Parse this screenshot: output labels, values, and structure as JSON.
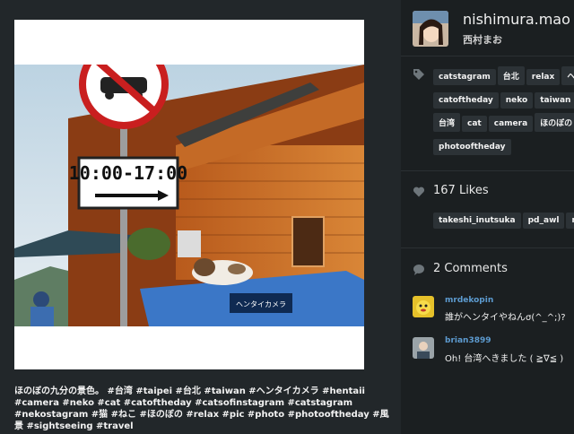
{
  "profile": {
    "username": "nishimura.mao",
    "real_name": "西村まお"
  },
  "tags": [
    "catstagram",
    "台北",
    "relax",
    "ヘン",
    "catoftheday",
    "neko",
    "taiwan",
    "n",
    "台湾",
    "cat",
    "camera",
    "ほのぼの",
    "photooftheday"
  ],
  "likes": {
    "count_label": "167 Likes",
    "users": [
      "takeshi_inutsuka",
      "pd_awl",
      "rinl"
    ]
  },
  "comments": {
    "title": "2 Comments",
    "items": [
      {
        "user": "mrdekopin",
        "text": "誰がヘンタイやねんσ(^_^;)?"
      },
      {
        "user": "brian3899",
        "text": "Oh! 台湾へきました ( ≧∇≦ ) "
      }
    ]
  },
  "photo": {
    "sign_hours": "10:00-17:00",
    "camera_sign_text": "ヘンタイカメラ"
  },
  "caption": "ほのぼの九分の景色。 #台湾 #taipei #台北 #taiwan #ヘンタイカメラ #hentaii #camera #neko #cat #catoftheday #catsofinstagram #catstagram #nekostagram #猫 #ねこ #ほのぼの #relax #pic #photo #photooftheday #風景 #sightseeing #travel",
  "icons": {
    "tag": "tag-icon",
    "heart": "heart-icon",
    "comment": "comment-bubble-icon"
  },
  "colors": {
    "background": "#1b1f21",
    "tag_bg": "#2c3236",
    "comment_username": "#5d9bd0"
  }
}
